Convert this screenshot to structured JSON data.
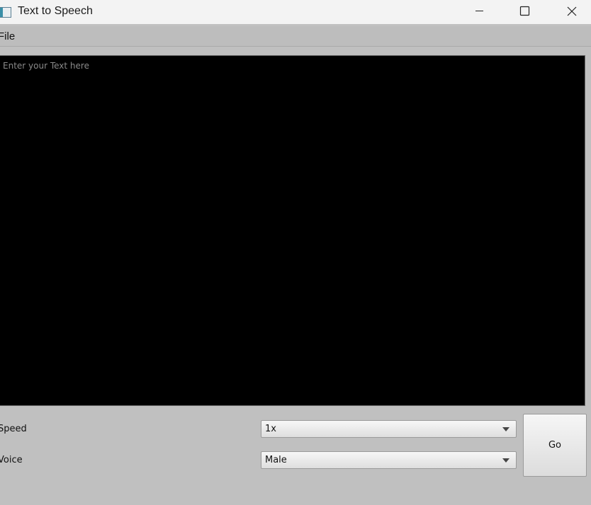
{
  "window": {
    "title": "Text to Speech",
    "icon": "app-window-icon",
    "controls": [
      "minimize-icon",
      "maximize-icon",
      "close-icon"
    ]
  },
  "menu": {
    "file_label": "File"
  },
  "editor": {
    "placeholder": "Enter your Text here",
    "value": ""
  },
  "controls": {
    "speed_label": "Speed",
    "speed_value": "1x",
    "voice_label": "Voice",
    "voice_value": "Male",
    "go_label": "Go"
  },
  "colors": {
    "window_bg": "#c0c0c0",
    "editor_bg": "#000000",
    "placeholder_text": "#8a8a8a"
  }
}
